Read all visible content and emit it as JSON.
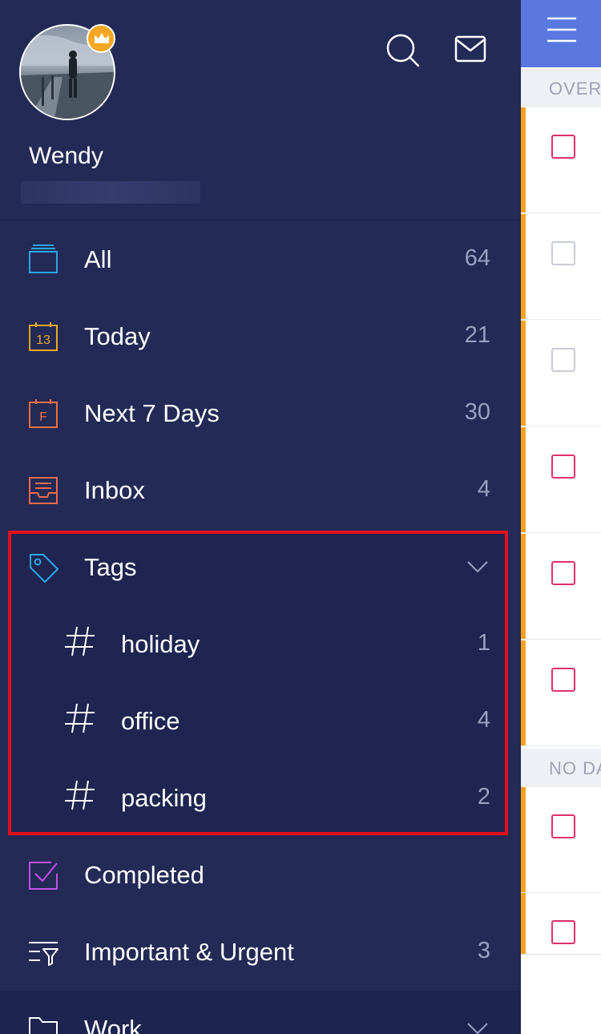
{
  "profile": {
    "name": "Wendy"
  },
  "nav": {
    "items": [
      {
        "label": "All",
        "count": "64",
        "icon": "inbox-stack-icon",
        "color": "#2aa7e6"
      },
      {
        "label": "Today",
        "count": "21",
        "icon": "calendar-today-icon",
        "calendar_number": "13",
        "color": "#f0a820"
      },
      {
        "label": "Next 7 Days",
        "count": "30",
        "icon": "calendar-week-icon",
        "calendar_letter": "F",
        "color": "#f0703c"
      },
      {
        "label": "Inbox",
        "count": "4",
        "icon": "tray-icon",
        "color": "#ef6a4e"
      }
    ],
    "tags": {
      "label": "Tags",
      "icon": "tag-icon",
      "items": [
        {
          "label": "holiday",
          "count": "1"
        },
        {
          "label": "office",
          "count": "4"
        },
        {
          "label": "packing",
          "count": "2"
        }
      ]
    },
    "completed": {
      "label": "Completed",
      "icon": "checkbox-checked-icon",
      "color": "#c450e6"
    },
    "important": {
      "label": "Important & Urgent",
      "count": "3",
      "icon": "filter-list-icon"
    },
    "work": {
      "label": "Work",
      "icon": "folder-icon"
    }
  },
  "task_panel": {
    "sections": [
      {
        "label": "OVER"
      },
      {
        "label": "NO DA"
      }
    ],
    "checkbox_colors": [
      "pink",
      "grey",
      "grey",
      "pink",
      "pink",
      "pink",
      "pink",
      "pink"
    ]
  },
  "colors": {
    "drawer_bg": "#232a55",
    "accent_blue": "#5a78e0",
    "highlight_border": "#e3101e",
    "priority_bar": "#f6a21e"
  }
}
